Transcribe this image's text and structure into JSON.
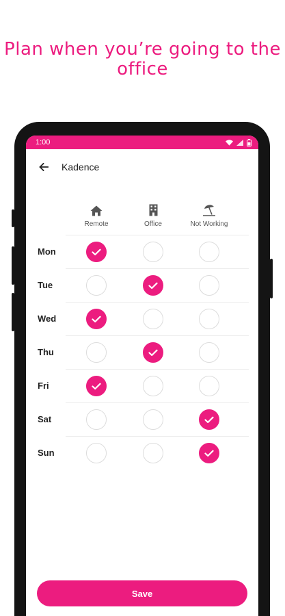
{
  "headline": "Plan when you’re going to the office",
  "status_bar": {
    "time": "1:00",
    "icons": [
      "wifi-icon",
      "signal-icon",
      "battery-icon"
    ]
  },
  "app_bar": {
    "title": "Kadence",
    "back_icon": "arrow-left-icon"
  },
  "columns": [
    {
      "key": "remote",
      "label": "Remote",
      "icon": "home-icon"
    },
    {
      "key": "office",
      "label": "Office",
      "icon": "building-icon"
    },
    {
      "key": "not_working",
      "label": "Not Working",
      "icon": "beach-umbrella-icon"
    }
  ],
  "days": [
    {
      "label": "Mon",
      "selected": "remote"
    },
    {
      "label": "Tue",
      "selected": "office"
    },
    {
      "label": "Wed",
      "selected": "remote"
    },
    {
      "label": "Thu",
      "selected": "office"
    },
    {
      "label": "Fri",
      "selected": "remote"
    },
    {
      "label": "Sat",
      "selected": "not_working"
    },
    {
      "label": "Sun",
      "selected": "not_working"
    }
  ],
  "save_label": "Save",
  "colors": {
    "accent": "#ec1c7f",
    "background": "#f2f2f2",
    "text": "#222222"
  }
}
